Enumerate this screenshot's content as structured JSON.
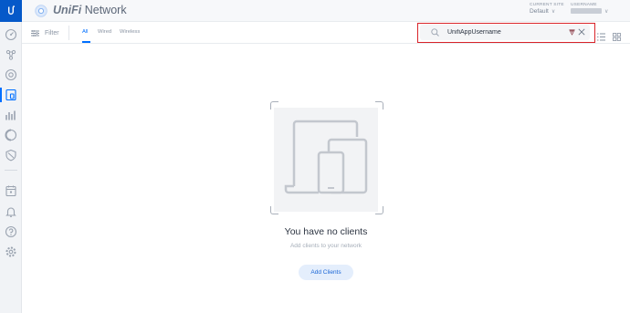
{
  "sidebar": {
    "logo_text": "U",
    "items": [
      {
        "icon": "dashboard-icon"
      },
      {
        "icon": "topology-icon"
      },
      {
        "icon": "devices-icon"
      },
      {
        "icon": "clients-icon",
        "active": true
      },
      {
        "icon": "statistics-icon"
      },
      {
        "icon": "insights-icon"
      },
      {
        "icon": "threat-management-icon"
      },
      {
        "icon": "events-icon"
      },
      {
        "icon": "alerts-icon"
      },
      {
        "icon": "support-icon"
      },
      {
        "icon": "settings-icon"
      }
    ]
  },
  "topbar": {
    "brand_unifi": "UniFi",
    "brand_network": "Network",
    "current_site_label": "CURRENT SITE",
    "current_site_value": "Default",
    "username_label": "USERNAME"
  },
  "subbar": {
    "filter_label": "Filter",
    "tabs": [
      {
        "label": "All",
        "active": true
      },
      {
        "label": "Wired"
      },
      {
        "label": "Wireless"
      }
    ]
  },
  "search": {
    "value": "UnifiAppUsername",
    "highlight_color": "#d9242a"
  },
  "empty_state": {
    "title": "You have no clients",
    "subtitle": "Add clients to your network",
    "button_label": "Add Clients"
  },
  "colors": {
    "accent": "#006fff",
    "logo_bg": "#0559c9"
  }
}
